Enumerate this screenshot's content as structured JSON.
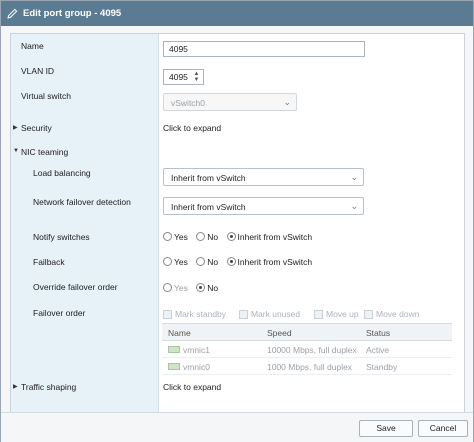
{
  "window": {
    "title": "Edit port group - 4095",
    "title_icon": "pencil-icon"
  },
  "fields": {
    "name": {
      "label": "Name",
      "value": "4095"
    },
    "vlan_id": {
      "label": "VLAN ID",
      "value": "4095"
    },
    "virtual_switch": {
      "label": "Virtual switch",
      "value": "vSwitch0",
      "disabled": true
    },
    "security": {
      "label": "Security",
      "value": "Click to expand",
      "expanded": false
    },
    "nic_teaming": {
      "label": "NIC teaming",
      "expanded": true,
      "load_balancing": {
        "label": "Load balancing",
        "value": "Inherit from vSwitch"
      },
      "network_failover_detection": {
        "label": "Network failover detection",
        "value": "Inherit from vSwitch"
      },
      "notify_switches": {
        "label": "Notify switches",
        "options": [
          "Yes",
          "No",
          "Inherit from vSwitch"
        ],
        "selected": "Inherit from vSwitch"
      },
      "failback": {
        "label": "Failback",
        "options": [
          "Yes",
          "No",
          "Inherit from vSwitch"
        ],
        "selected": "Inherit from vSwitch"
      },
      "override_failover_order": {
        "label": "Override failover order",
        "options": [
          "Yes",
          "No"
        ],
        "selected": "No"
      },
      "failover_order": {
        "label": "Failover order",
        "toolbar": [
          "Mark standby",
          "Mark unused",
          "Move up",
          "Move down"
        ],
        "columns": [
          "Name",
          "Speed",
          "Status"
        ],
        "rows": [
          {
            "name": "vmnic1",
            "speed": "10000 Mbps, full duplex",
            "status": "Active"
          },
          {
            "name": "vmnic0",
            "speed": "1000 Mbps, full duplex",
            "status": "Standby"
          }
        ]
      }
    },
    "traffic_shaping": {
      "label": "Traffic shaping",
      "value": "Click to expand",
      "expanded": false
    }
  },
  "footer": {
    "save_label": "Save",
    "cancel_label": "Cancel"
  },
  "colors": {
    "titlebar": "#5b7b93",
    "label_column": "#e6f1f8"
  }
}
